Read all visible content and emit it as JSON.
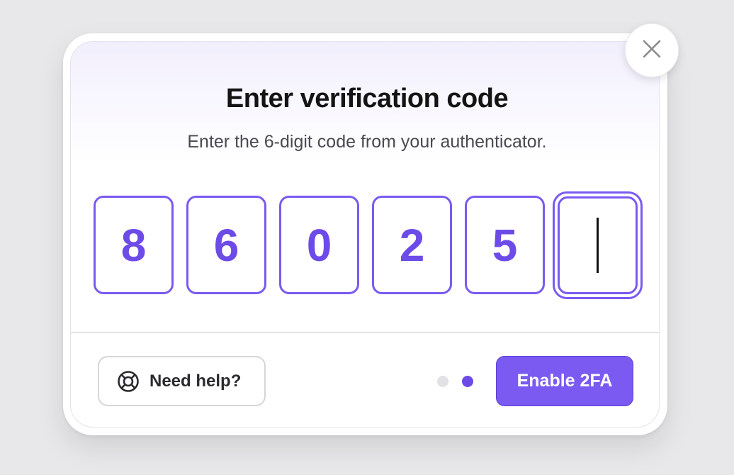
{
  "dialog": {
    "title": "Enter verification code",
    "subtitle": "Enter the 6-digit code from your authenticator.",
    "close_icon": "close-icon"
  },
  "code_inputs": {
    "digits": [
      "8",
      "6",
      "0",
      "2",
      "5",
      ""
    ],
    "active_index": 5
  },
  "footer": {
    "help_label": "Need help?",
    "help_icon": "lifebuoy-icon",
    "steps_total": 2,
    "steps_current": 2,
    "enable_label": "Enable 2FA"
  },
  "colors": {
    "accent": "#7a5af0",
    "digit_text": "#6d4be8",
    "title": "#141414",
    "subtitle": "#4a4a4f",
    "page_bg": "#e8e8ea"
  }
}
